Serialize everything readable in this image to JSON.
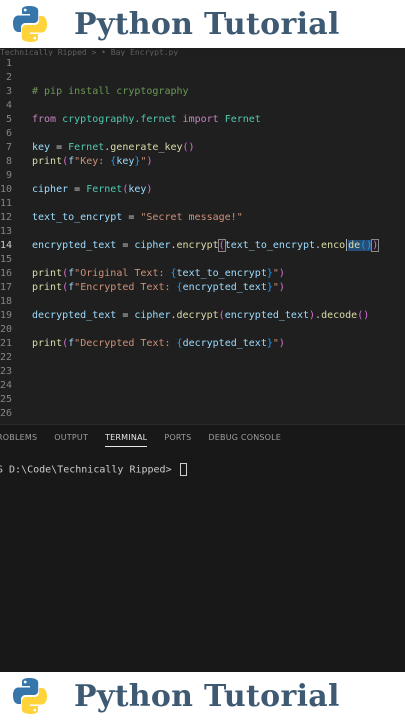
{
  "banner": {
    "title": "Python Tutorial"
  },
  "editor": {
    "breadcrumb": "Technically Ripped > • Bay_Encrypt.py",
    "active_line": "14",
    "lines": [
      {
        "n": "1"
      },
      {
        "n": "2"
      },
      {
        "n": "3",
        "comment": "# pip install cryptography"
      },
      {
        "n": "4"
      },
      {
        "n": "5",
        "kw1": "from",
        "mod": "cryptography.fernet",
        "kw2": "import",
        "cls": "Fernet"
      },
      {
        "n": "6"
      },
      {
        "n": "7",
        "var": "key",
        "eq": " = ",
        "cls": "Fernet",
        "dot": ".",
        "fn": "generate_key",
        "call": "()"
      },
      {
        "n": "8",
        "fn": "print",
        "p1": "(",
        "f": "f",
        "str1": "\"Key: ",
        "b1": "{",
        "v": "key",
        "b2": "}",
        "str2": "\"",
        "p2": ")"
      },
      {
        "n": "9"
      },
      {
        "n": "10",
        "var": "cipher",
        "eq": " = ",
        "cls": "Fernet",
        "p1": "(",
        "arg": "key",
        "p2": ")"
      },
      {
        "n": "11"
      },
      {
        "n": "12",
        "var": "text_to_encrypt",
        "eq": " = ",
        "str": "\"Secret message!\""
      },
      {
        "n": "13"
      },
      {
        "n": "14",
        "var": "encrypted_text",
        "eq": " = ",
        "obj": "cipher",
        "dot": ".",
        "fn": "encrypt",
        "p1": "(",
        "arg": "text_to_encrypt",
        "dot2": ".",
        "fn2a": "enco",
        "fn2b": "de",
        "call": "()",
        "p2": ")"
      },
      {
        "n": "15"
      },
      {
        "n": "16",
        "fn": "print",
        "p1": "(",
        "f": "f",
        "str1": "\"Original Text: ",
        "b1": "{",
        "v": "text_to_encrypt",
        "b2": "}",
        "str2": "\"",
        "p2": ")"
      },
      {
        "n": "17",
        "fn": "print",
        "p1": "(",
        "f": "f",
        "str1": "\"Encrypted Text: ",
        "b1": "{",
        "v": "encrypted_text",
        "b2": "}",
        "str2": "\"",
        "p2": ")"
      },
      {
        "n": "18"
      },
      {
        "n": "19",
        "var": "decrypted_text",
        "eq": " = ",
        "obj": "cipher",
        "dot": ".",
        "fn": "decrypt",
        "p1": "(",
        "arg": "encrypted_text",
        "p2": ")",
        "dot2": ".",
        "fn2": "decode",
        "call": "()"
      },
      {
        "n": "20"
      },
      {
        "n": "21",
        "fn": "print",
        "p1": "(",
        "f": "f",
        "str1": "\"Decrypted Text: ",
        "b1": "{",
        "v": "decrypted_text",
        "b2": "}",
        "str2": "\"",
        "p2": ")"
      },
      {
        "n": "22"
      },
      {
        "n": "23"
      },
      {
        "n": "24"
      },
      {
        "n": "25"
      },
      {
        "n": "26"
      }
    ]
  },
  "panel": {
    "tabs": [
      "ROBLEMS",
      "OUTPUT",
      "TERMINAL",
      "PORTS",
      "DEBUG CONSOLE"
    ],
    "active_tab": "TERMINAL",
    "prompt": "S D:\\Code\\Technically Ripped> "
  },
  "colors": {
    "banner_text": "#3e5a73",
    "python_blue": "#3776ab",
    "python_yellow": "#ffd43b"
  }
}
